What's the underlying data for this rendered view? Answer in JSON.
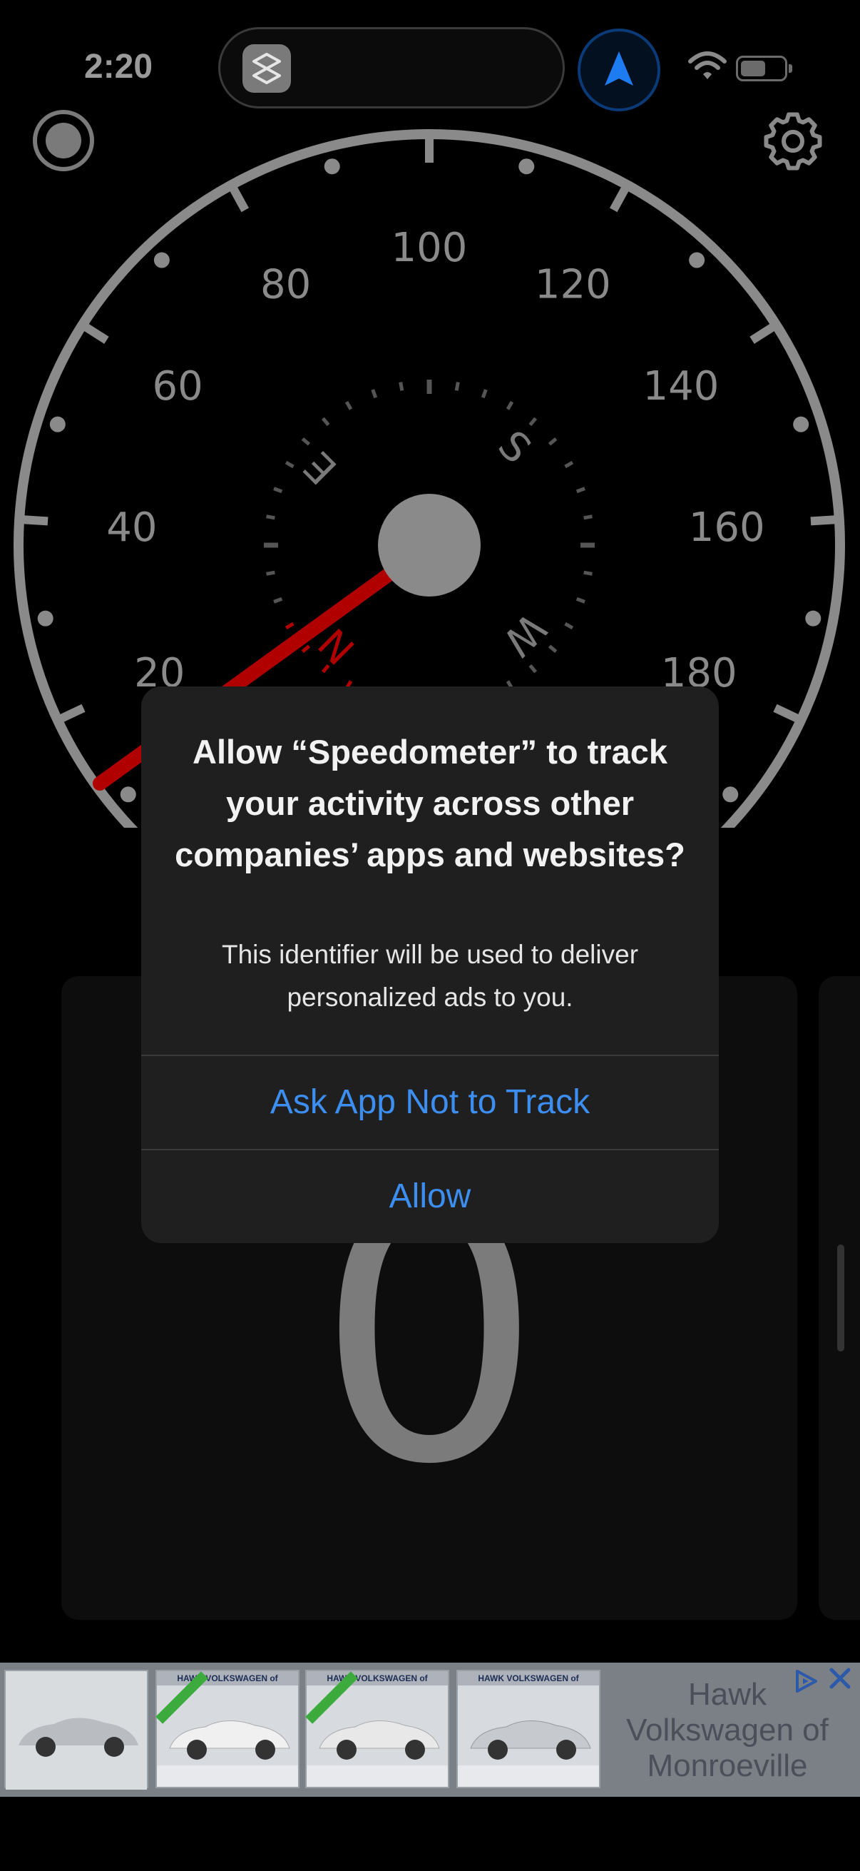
{
  "status_bar": {
    "time": "2:20"
  },
  "gauge": {
    "speed_labels": [
      "20",
      "40",
      "60",
      "80",
      "100",
      "120",
      "140",
      "160",
      "180"
    ],
    "compass": {
      "n": "N",
      "e": "E",
      "s": "S",
      "w": "W"
    },
    "needle_color": "#b00000",
    "gauge_color": "#8a8a8a"
  },
  "speed_card": {
    "value": "0"
  },
  "alert": {
    "title": "Allow “Speedometer” to track your activity across other companies’ apps and websites?",
    "message": "This identifier will be used to deliver personalized ads to you.",
    "button_ask_not_track": "Ask App Not to Track",
    "button_allow": "Allow",
    "accent_color": "#3c8ef0"
  },
  "ad": {
    "headline": "Hawk Volkswagen of Monroeville",
    "banner_text": "HAWK VOLKSWAGEN of MONROEVILLE",
    "choices_icon": "ad-choices-icon",
    "close_icon": "close-icon"
  }
}
